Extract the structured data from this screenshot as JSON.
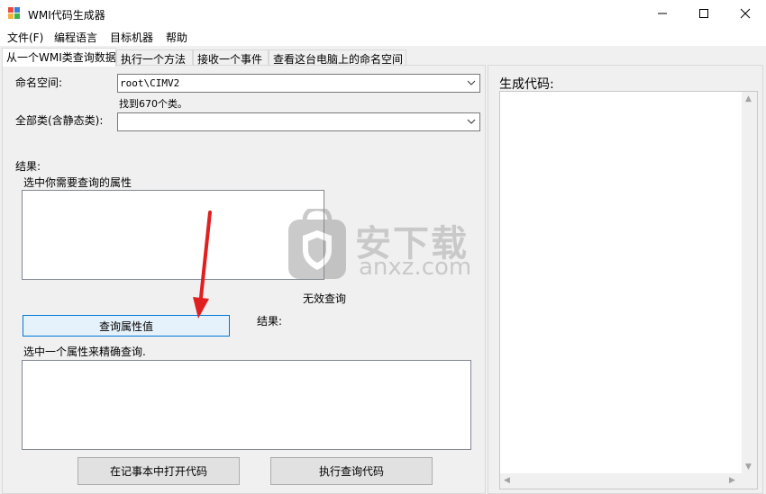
{
  "window": {
    "title": "WMI代码生成器",
    "minimize_glyph": "—",
    "maximize_glyph": "☐",
    "close_glyph": "✕"
  },
  "menu": {
    "items": [
      {
        "label": "文件(F)"
      },
      {
        "label": "编程语言"
      },
      {
        "label": "目标机器"
      },
      {
        "label": "帮助"
      }
    ]
  },
  "tabs": [
    {
      "label": "从一个WMI类查询数据",
      "active": true
    },
    {
      "label": "执行一个方法",
      "active": false
    },
    {
      "label": "接收一个事件",
      "active": false
    },
    {
      "label": "查看这台电脑上的命名空间",
      "active": false
    }
  ],
  "query": {
    "namespace_label": "命名空间:",
    "namespace_value": "root\\CIMV2",
    "found_text": "找到670个类。",
    "class_label": "全部类(含静态类):",
    "class_value": "",
    "results_label": "结果:",
    "select_props_label": "选中你需要查询的属性",
    "invalid_query_text": "无效查询",
    "query_button": "查询属性值",
    "results2_label": "结果:",
    "select_one_label": "选中一个属性来精确查询."
  },
  "footer_buttons": {
    "open_notepad": "在记事本中打开代码",
    "execute": "执行查询代码"
  },
  "code_panel": {
    "title": "生成代码:"
  },
  "watermark": {
    "text": "安下载",
    "domain": "anxz.com"
  },
  "colors": {
    "accent_red_arrow": "#e02020",
    "focus_blue": "#0078d7"
  }
}
